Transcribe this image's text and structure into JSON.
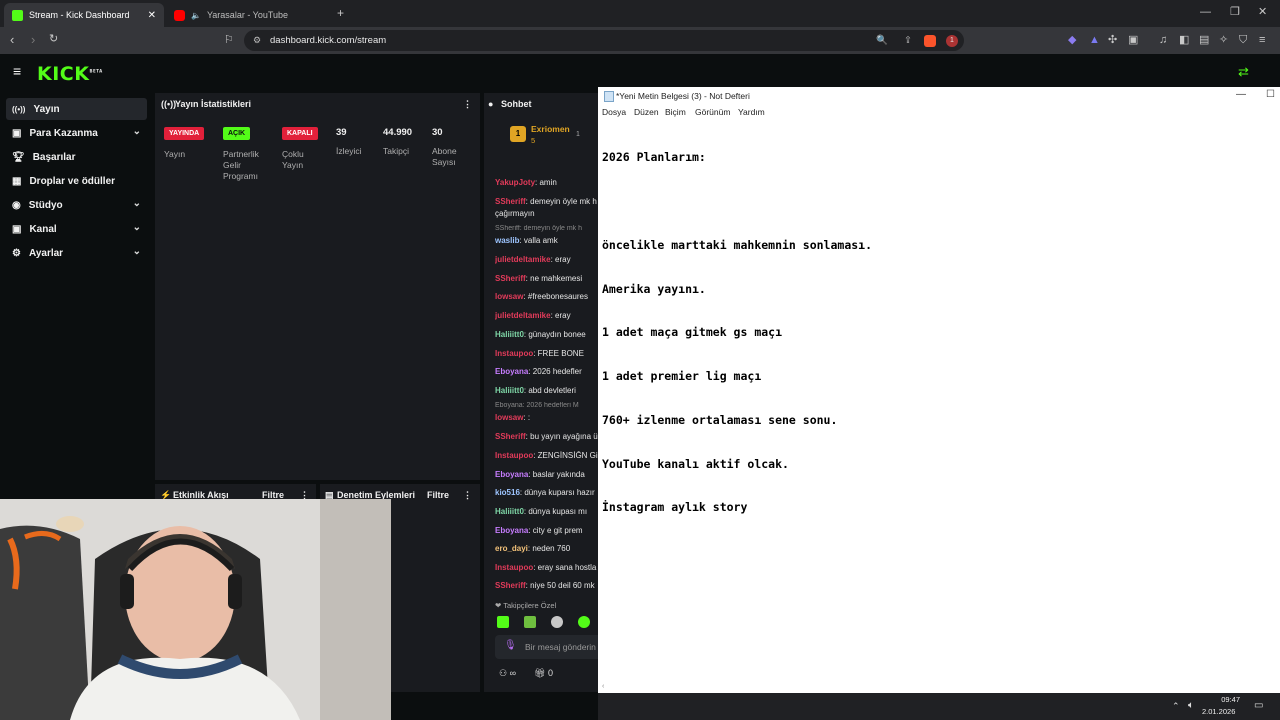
{
  "browser": {
    "tabs": [
      {
        "title": "Stream - Kick Dashboard",
        "active": true
      },
      {
        "title": "Yarasalar - YouTube",
        "active": false
      }
    ],
    "url": "dashboard.kick.com/stream",
    "extension_badge": "1"
  },
  "kick": {
    "logo": "KICK",
    "logo_sup": "BETA",
    "accent": "#53fc18"
  },
  "sidebar": {
    "items": [
      {
        "label": "Yayın",
        "icon": "broadcast-icon",
        "selected": true
      },
      {
        "label": "Para Kazanma",
        "icon": "money-icon",
        "chevron": true
      },
      {
        "label": "Başarılar",
        "icon": "trophy-icon"
      },
      {
        "label": "Droplar ve ödüller",
        "icon": "drops-icon"
      },
      {
        "label": "Stüdyo",
        "icon": "studio-icon",
        "chevron": true
      },
      {
        "label": "Kanal",
        "icon": "channel-icon",
        "chevron": true
      },
      {
        "label": "Ayarlar",
        "icon": "gear-icon",
        "chevron": true
      }
    ]
  },
  "stats": {
    "title": "Yayın İstatistikleri",
    "badges": [
      {
        "text": "YAYINDA",
        "label": "Yayın"
      },
      {
        "text": "AÇIK",
        "label": "Partnerlik Gelir Programı"
      },
      {
        "text": "KAPALI",
        "label": "Çoklu Yayın"
      }
    ],
    "numbers": [
      {
        "value": "39",
        "label": "İzleyici"
      },
      {
        "value": "44.990",
        "label": "Takipçi"
      },
      {
        "value": "30",
        "label": "Abone Sayısı"
      }
    ]
  },
  "activity": {
    "title": "Etkinlik Akışı",
    "filter": "Filtre"
  },
  "moderation": {
    "title": "Denetim Eylemleri",
    "filter": "Filtre"
  },
  "chat": {
    "title": "Sohbet",
    "pinned_user": "Exriomen",
    "pinned_count": "5",
    "side_count": "1",
    "messages": [
      {
        "user": "YakupJoty",
        "text": "amin",
        "color": "#e23b5a"
      },
      {
        "user": "SSheriff",
        "text": "demeyin öyle mk h",
        "color": "#e23b5a"
      },
      {
        "user": "",
        "text": "çağırmayın",
        "color": "#e23b5a"
      },
      {
        "user": "",
        "text": "SSheriff: demeyin öyle mk h",
        "color": "#888888",
        "reply": true
      },
      {
        "user": "waslib",
        "text": "valla amk",
        "color": "#9ec5ff"
      },
      {
        "user": "julietdeltamike",
        "text": "eray",
        "color": "#e23b5a"
      },
      {
        "user": "SSheriff",
        "text": "ne mahkemesi",
        "color": "#e23b5a"
      },
      {
        "user": "lowsaw",
        "text": "#freebonesaures",
        "color": "#e23b5a"
      },
      {
        "user": "julietdeltamike",
        "text": "eray",
        "color": "#e23b5a"
      },
      {
        "user": "Haliiitt0",
        "text": "günaydın bonee",
        "color": "#7fd7a7"
      },
      {
        "user": "Instaupoo",
        "text": "FREE BONE",
        "color": "#e23b5a"
      },
      {
        "user": "Eboyana",
        "text": "2026 hedefler",
        "color": "#c77dff"
      },
      {
        "user": "Haliiitt0",
        "text": "abd devletleri",
        "color": "#7fd7a7"
      },
      {
        "user": "",
        "text": "Eboyana: 2026 hedefleri M",
        "color": "#888888",
        "reply": true
      },
      {
        "user": "lowsaw",
        "text": ":",
        "color": "#e23b5a"
      },
      {
        "user": "SSheriff",
        "text": "bu yayın ayağına ü",
        "color": "#e23b5a"
      },
      {
        "user": "Instaupoo",
        "text": "ZENGİNSİĞN Gid",
        "color": "#e23b5a"
      },
      {
        "user": "Eboyana",
        "text": "baslar yakında",
        "color": "#c77dff"
      },
      {
        "user": "kio516",
        "text": "dünya kuparsı hazır",
        "color": "#9ec5ff"
      },
      {
        "user": "Haliiitt0",
        "text": "dünya kupası mı",
        "color": "#7fd7a7"
      },
      {
        "user": "Eboyana",
        "text": "city e git prem",
        "color": "#c77dff"
      },
      {
        "user": "ero_dayi",
        "text": "neden 760",
        "color": "#f3c27a"
      },
      {
        "user": "Instaupoo",
        "text": "eray sana hostla",
        "color": "#e23b5a"
      },
      {
        "user": "SSheriff",
        "text": "niye 50 deil 60 mk",
        "color": "#e23b5a"
      }
    ],
    "followers_only": "Takipçilere Özel",
    "input_placeholder": "Bir mesaj gönderin",
    "footer_infinity": "∞",
    "footer_count": "0"
  },
  "notepad": {
    "title": "*Yeni Metin Belgesi (3) - Not Defteri",
    "menu": [
      "Dosya",
      "Düzen",
      "Biçim",
      "Görünüm",
      "Yardım"
    ],
    "lines": [
      "2026 Planlarım:",
      "",
      "öncelikle marttaki mahkemnin sonlaması.",
      "Amerika yayını.",
      "1 adet maça gitmek gs maçı",
      "1 adet premier lig maçı",
      "760+ izlenme ortalaması sene sonu.",
      "YouTube kanalı aktif olcak.",
      "İnstagram aylık story"
    ]
  },
  "taskbar": {
    "time": "09:47",
    "date": "2.01.2026"
  }
}
